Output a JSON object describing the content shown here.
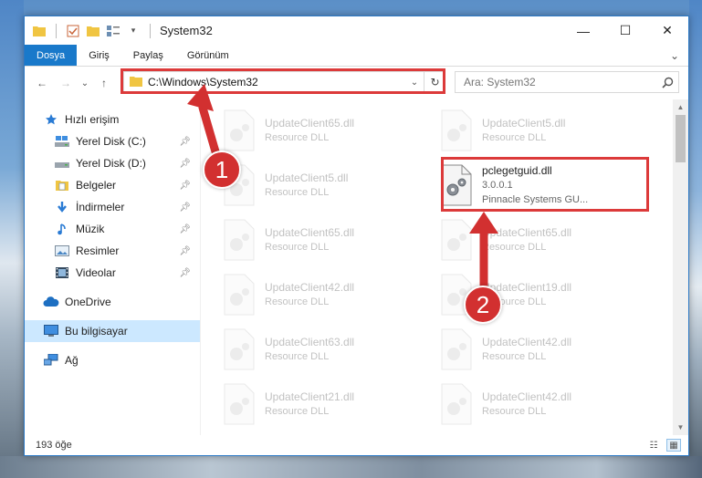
{
  "window": {
    "title": "System32",
    "controls": {
      "minimize": "—",
      "maximize": "☐",
      "close": "✕"
    }
  },
  "ribbon": {
    "tabs": [
      "Dosya",
      "Giriş",
      "Paylaş",
      "Görünüm"
    ],
    "active_tab": "Dosya",
    "expand": "⌄"
  },
  "navigation": {
    "back": "←",
    "forward": "→",
    "recent": "⌄",
    "up": "↑",
    "address": "C:\\Windows\\System32",
    "address_dropdown": "⌄",
    "refresh": "↻",
    "search_placeholder": "Ara: System32"
  },
  "sidebar": {
    "quick_access": "Hızlı erişim",
    "items": [
      {
        "label": "Yerel Disk (C:)",
        "icon": "drive-icon",
        "pinned": true
      },
      {
        "label": "Yerel Disk (D:)",
        "icon": "drive-icon",
        "pinned": true
      },
      {
        "label": "Belgeler",
        "icon": "documents-icon",
        "pinned": true
      },
      {
        "label": "İndirmeler",
        "icon": "downloads-icon",
        "pinned": true
      },
      {
        "label": "Müzik",
        "icon": "music-icon",
        "pinned": true
      },
      {
        "label": "Resimler",
        "icon": "pictures-icon",
        "pinned": true
      },
      {
        "label": "Videolar",
        "icon": "videos-icon",
        "pinned": true
      }
    ],
    "onedrive": "OneDrive",
    "this_pc": "Bu bilgisayar",
    "network": "Ağ"
  },
  "files": {
    "left": [
      {
        "name": "UpdateClient65.dll",
        "desc": "Resource DLL"
      },
      {
        "name": "UpdateClient5.dll",
        "desc": "Resource DLL"
      },
      {
        "name": "UpdateClient65.dll",
        "desc": "Resource DLL"
      },
      {
        "name": "UpdateClient42.dll",
        "desc": "Resource DLL"
      },
      {
        "name": "UpdateClient63.dll",
        "desc": "Resource DLL"
      },
      {
        "name": "UpdateClient21.dll",
        "desc": "Resource DLL"
      }
    ],
    "right": [
      {
        "name": "UpdateClient5.dll",
        "desc": "Resource DLL"
      },
      {
        "name": "pclegetguid.dll",
        "version": "3.0.0.1",
        "desc": "Pinnacle Systems GU..."
      },
      {
        "name": "UpdateClient65.dll",
        "desc": "Resource DLL"
      },
      {
        "name": "UpdateClient19.dll",
        "desc": "Resource DLL"
      },
      {
        "name": "UpdateClient42.dll",
        "desc": "Resource DLL"
      },
      {
        "name": "UpdateClient42.dll",
        "desc": "Resource DLL"
      }
    ]
  },
  "status": {
    "count": "193 öğe"
  },
  "annotations": {
    "step1": "1",
    "step2": "2",
    "highlight_color": "#dc3a3a"
  },
  "colors": {
    "accent": "#1979ca",
    "selected": "#cce8ff"
  }
}
